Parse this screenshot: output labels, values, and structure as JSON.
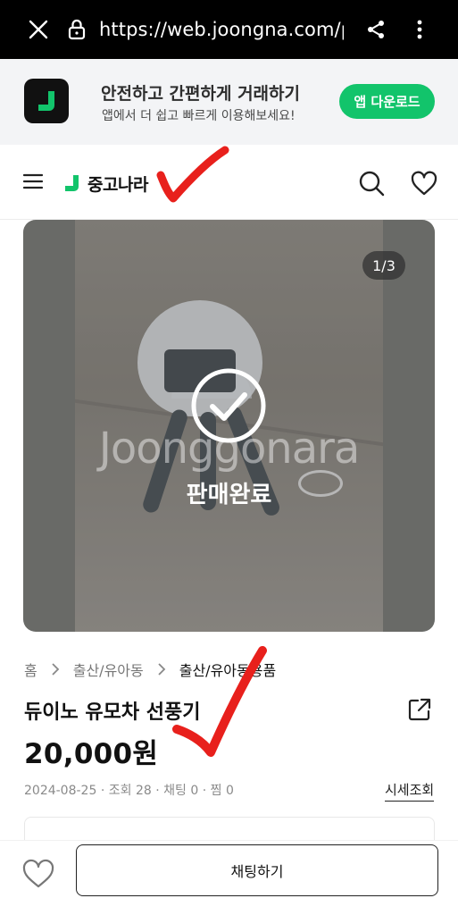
{
  "browser": {
    "url": "https://web.joongna.com/product/"
  },
  "app_banner": {
    "title": "안전하고 간편하게 거래하기",
    "subtitle": "앱에서 더 쉽고 빠르게 이용해보세요!",
    "download_label": "앱 다운로드"
  },
  "header": {
    "brand_name": "중고나라"
  },
  "product": {
    "image_counter": "1/3",
    "watermark": "Joonggonara",
    "status_label": "판매완료",
    "breadcrumb": [
      "홈",
      "출산/유아동",
      "출산/유아동용품"
    ],
    "title": "듀이노 유모차 선풍기",
    "price": "20,000원",
    "meta": {
      "date": "2024-08-25",
      "views": "조회 28",
      "chats": "채팅 0",
      "likes": "찜 0",
      "separator": " · "
    },
    "market_price_link": "시세조회"
  },
  "bottom_bar": {
    "chat_label": "채팅하기"
  },
  "colors": {
    "brand_green": "#12c46b",
    "annotation_red": "#e8201c"
  }
}
